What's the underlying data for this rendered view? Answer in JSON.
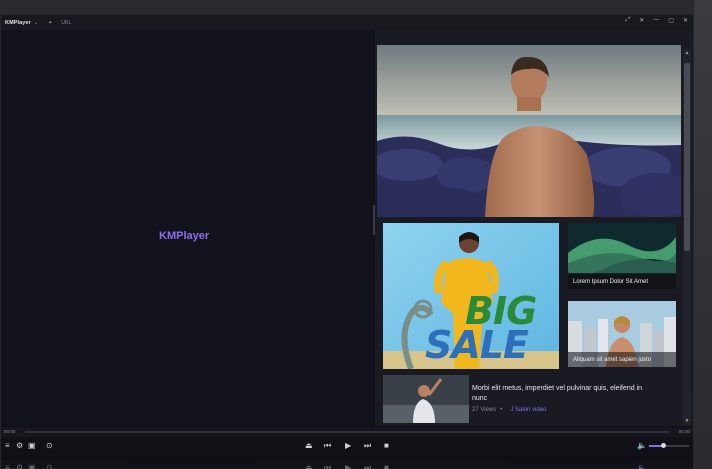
{
  "titlebar": {
    "logo": "KMPlayer",
    "menu_chevron": "⌄",
    "pin_icon": "pin-icon",
    "url_label": "URL",
    "controls": [
      "⤢",
      "✕",
      "—",
      "▢",
      "✕"
    ]
  },
  "video": {
    "brand": "KMPlayer"
  },
  "panel": {
    "tiles": [
      {
        "caption": "Lorem Ipsum Dolor Sit Amet"
      },
      {
        "caption": "Aliquam sit amet sapien justo"
      }
    ],
    "banner": {
      "line1": "BIG",
      "line2": "SALE"
    },
    "list_item": {
      "title": "Morbi elit metus, imperdiet vel pulvinar quis, eleifend in nunc",
      "views": "27 Views",
      "channel": "J Salon video"
    }
  },
  "seek": {
    "current": "00:00",
    "total": "00:00"
  },
  "colors": {
    "accent": "#8e6cf0",
    "background": "#0e0e14"
  },
  "playback": {
    "volume": 0.35
  }
}
